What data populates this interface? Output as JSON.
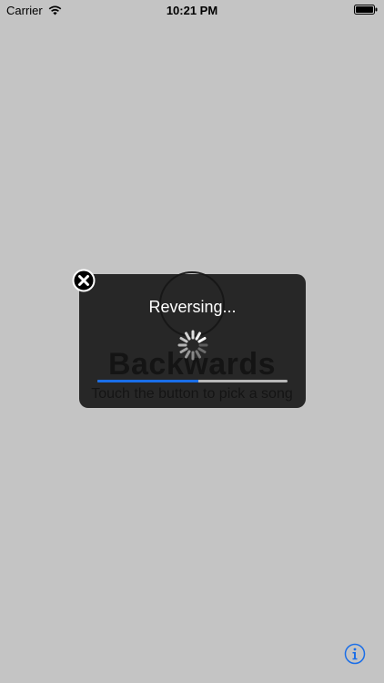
{
  "status_bar": {
    "carrier": "Carrier",
    "time": "10:21 PM"
  },
  "background": {
    "title": "Backwards",
    "subtitle": "Touch the button to pick a song"
  },
  "hud": {
    "title": "Reversing...",
    "progress": 0.53
  },
  "icons": {
    "wifi": "wifi-icon",
    "battery": "battery-icon",
    "close": "close-icon",
    "spinner": "spinner-icon",
    "info": "info-icon"
  },
  "colors": {
    "background": "#c4c4c4",
    "hud": "#161616",
    "progress": "#1a6ee8",
    "info": "#1a6ee8"
  }
}
